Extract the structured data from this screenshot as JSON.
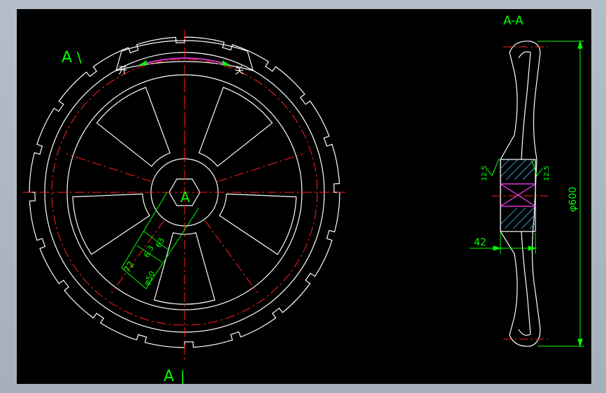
{
  "labels": {
    "view_top": "A",
    "view_bottom": "A",
    "view_mark_slash": "\\",
    "view_mark_bar": "|",
    "section_title": "A-A",
    "hub_letter": "A",
    "open_char": "开",
    "close_char": "关"
  },
  "dimensions": {
    "diameter": "φ600",
    "width_42": "42",
    "d72": "72",
    "d63a": "63",
    "d63b": "6.3",
    "d50": "φ50",
    "rough_left": "12.5",
    "rough_right": "12.5"
  },
  "colors": {
    "background": "#000000",
    "line": "#ffffff",
    "center": "#ff2020",
    "dimension": "#00ff00",
    "hatch": "#40c0ff",
    "magenta": "#ff40ff"
  }
}
